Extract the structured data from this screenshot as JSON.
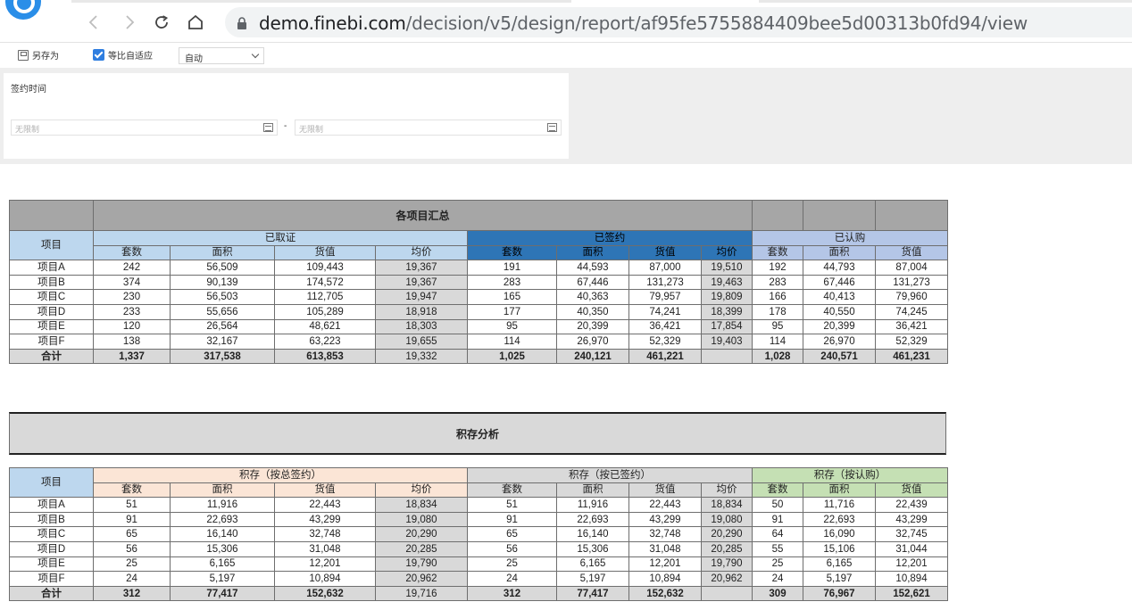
{
  "browser": {
    "url_host": "demo.finebi.com",
    "url_path": "/decision/v5/design/report/af95fe5755884409bee5d00313b0fd94/view"
  },
  "toolbar": {
    "save_as_label": "另存为",
    "fit_label": "等比自适应",
    "fit_checked": true,
    "zoom_select_value": "自动"
  },
  "filter": {
    "label": "签约时间",
    "start_placeholder": "无限制",
    "end_placeholder": "无限制",
    "separator": "-"
  },
  "summary_table": {
    "title": "各项目汇总",
    "project_header": "项目",
    "groups": [
      "已取证",
      "已签约",
      "已认购"
    ],
    "sub_headers": [
      "套数",
      "面积",
      "货值",
      "均价",
      "套数",
      "面积",
      "货值",
      "均价",
      "套数",
      "面积",
      "货值"
    ],
    "rows": [
      {
        "name": "项目A",
        "values": [
          "242",
          "56,509",
          "109,443",
          "19,367",
          "191",
          "44,593",
          "87,000",
          "19,510",
          "192",
          "44,793",
          "87,004"
        ]
      },
      {
        "name": "项目B",
        "values": [
          "374",
          "90,139",
          "174,572",
          "19,367",
          "283",
          "67,446",
          "131,273",
          "19,463",
          "283",
          "67,446",
          "131,273"
        ]
      },
      {
        "name": "项目C",
        "values": [
          "230",
          "56,503",
          "112,705",
          "19,947",
          "165",
          "40,363",
          "79,957",
          "19,809",
          "166",
          "40,413",
          "79,960"
        ]
      },
      {
        "name": "项目D",
        "values": [
          "233",
          "55,656",
          "105,289",
          "18,918",
          "177",
          "40,350",
          "74,241",
          "18,399",
          "178",
          "40,550",
          "74,245"
        ]
      },
      {
        "name": "项目E",
        "values": [
          "120",
          "26,564",
          "48,621",
          "18,303",
          "95",
          "20,399",
          "36,421",
          "17,854",
          "95",
          "20,399",
          "36,421"
        ]
      },
      {
        "name": "项目F",
        "values": [
          "138",
          "32,167",
          "63,223",
          "19,655",
          "114",
          "26,970",
          "52,329",
          "19,403",
          "114",
          "26,970",
          "52,329"
        ]
      }
    ],
    "total": {
      "name": "合计",
      "values": [
        "1,337",
        "317,538",
        "613,853",
        "19,332",
        "1,025",
        "240,121",
        "461,221",
        "",
        "1,028",
        "240,571",
        "461,231"
      ]
    }
  },
  "inventory_title": "积存分析",
  "inventory_table": {
    "project_header": "项目",
    "groups": [
      "积存（按总签约）",
      "积存（按已签约）",
      "积存（按认购）"
    ],
    "sub_headers": [
      "套数",
      "面积",
      "货值",
      "均价",
      "套数",
      "面积",
      "货值",
      "均价",
      "套数",
      "面积",
      "货值"
    ],
    "rows": [
      {
        "name": "项目A",
        "values": [
          "51",
          "11,916",
          "22,443",
          "18,834",
          "51",
          "11,916",
          "22,443",
          "18,834",
          "50",
          "11,716",
          "22,439"
        ]
      },
      {
        "name": "项目B",
        "values": [
          "91",
          "22,693",
          "43,299",
          "19,080",
          "91",
          "22,693",
          "43,299",
          "19,080",
          "91",
          "22,693",
          "43,299"
        ]
      },
      {
        "name": "项目C",
        "values": [
          "65",
          "16,140",
          "32,748",
          "20,290",
          "65",
          "16,140",
          "32,748",
          "20,290",
          "64",
          "16,090",
          "32,745"
        ]
      },
      {
        "name": "项目D",
        "values": [
          "56",
          "15,306",
          "31,048",
          "20,285",
          "56",
          "15,306",
          "31,048",
          "20,285",
          "55",
          "15,106",
          "31,044"
        ]
      },
      {
        "name": "项目E",
        "values": [
          "25",
          "6,165",
          "12,201",
          "19,790",
          "25",
          "6,165",
          "12,201",
          "19,790",
          "25",
          "6,165",
          "12,201"
        ]
      },
      {
        "name": "项目F",
        "values": [
          "24",
          "5,197",
          "10,894",
          "20,962",
          "24",
          "5,197",
          "10,894",
          "20,962",
          "24",
          "5,197",
          "10,894"
        ]
      }
    ],
    "total": {
      "name": "合计",
      "values": [
        "312",
        "77,417",
        "152,632",
        "19,716",
        "312",
        "77,417",
        "152,632",
        "",
        "309",
        "76,967",
        "152,621"
      ]
    }
  }
}
